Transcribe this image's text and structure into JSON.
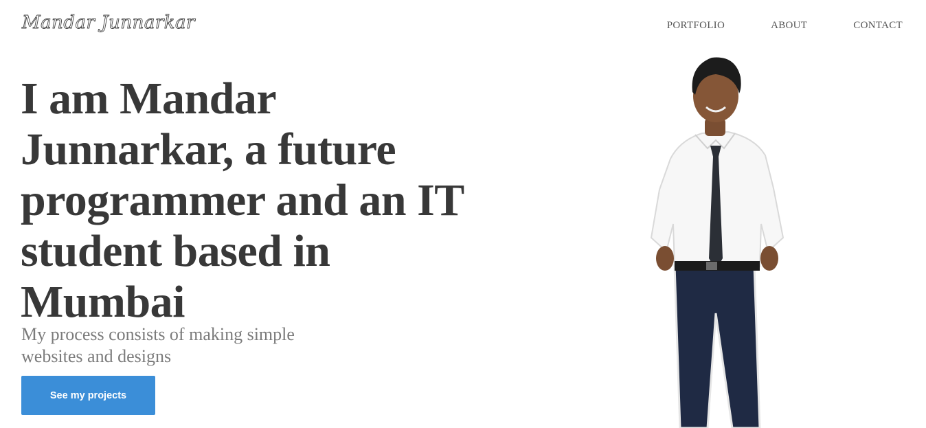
{
  "header": {
    "logo_text": "Mandar Junnarkar",
    "nav": [
      {
        "label": "PORTFOLIO"
      },
      {
        "label": "ABOUT"
      },
      {
        "label": "CONTACT"
      }
    ]
  },
  "hero": {
    "title": "I am Mandar Junnarkar, a future programmer and an IT student based in Mumbai",
    "subtitle": "My process consists of making simple websites and designs",
    "cta_label": "See my projects"
  },
  "colors": {
    "cta_background": "#3b8ed8",
    "heading": "#383838",
    "subtitle": "#7b7b7b",
    "nav_text": "#555555"
  }
}
